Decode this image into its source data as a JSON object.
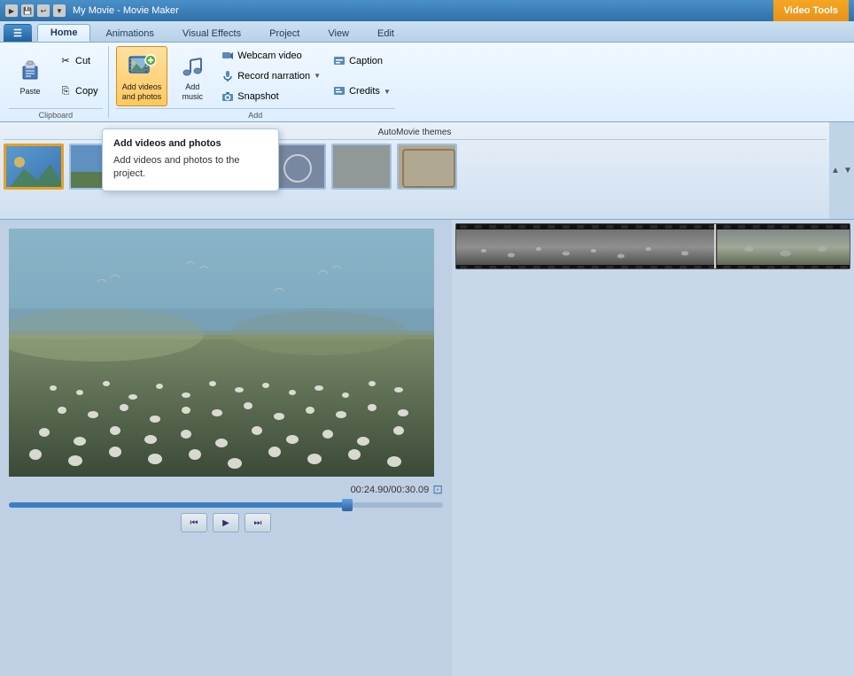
{
  "titleBar": {
    "appIcon": "▶",
    "title": "My Movie - Movie Maker",
    "videoToolsBadge": "Video Tools"
  },
  "tabs": [
    {
      "id": "app",
      "label": "≡",
      "isApp": true
    },
    {
      "id": "home",
      "label": "Home",
      "active": true
    },
    {
      "id": "animations",
      "label": "Animations"
    },
    {
      "id": "visualEffects",
      "label": "Visual Effects"
    },
    {
      "id": "project",
      "label": "Project"
    },
    {
      "id": "view",
      "label": "View"
    },
    {
      "id": "edit",
      "label": "Edit"
    }
  ],
  "ribbon": {
    "groups": [
      {
        "id": "clipboard",
        "label": "Clipboard",
        "buttons": [
          {
            "id": "paste",
            "label": "Paste",
            "size": "large",
            "icon": "paste"
          },
          {
            "id": "cut",
            "label": "Cut",
            "size": "small",
            "icon": "scissors"
          },
          {
            "id": "copy",
            "label": "Copy",
            "size": "small",
            "icon": "copy"
          }
        ]
      },
      {
        "id": "add",
        "label": "Add",
        "buttons": [
          {
            "id": "addVideos",
            "label": "Add videos\nand photos",
            "size": "large",
            "icon": "film-add",
            "active": true
          },
          {
            "id": "addMusic",
            "label": "Add\nmusic",
            "size": "large",
            "icon": "music-add"
          },
          {
            "id": "webcamVideo",
            "label": "Webcam video",
            "size": "small",
            "icon": "webcam"
          },
          {
            "id": "recordNarration",
            "label": "Record narration",
            "size": "small",
            "icon": "mic",
            "hasDropdown": true
          },
          {
            "id": "snapshot",
            "label": "Snapshot",
            "size": "small",
            "icon": "camera"
          },
          {
            "id": "caption",
            "label": "Caption",
            "size": "small",
            "icon": "caption"
          },
          {
            "id": "credits",
            "label": "Credits",
            "size": "small",
            "icon": "credits",
            "hasDropdown": true
          }
        ]
      }
    ]
  },
  "themesArea": {
    "label": "AutoMovie themes",
    "themes": [
      {
        "id": "t1",
        "selected": true,
        "colorClass": "thumb-1"
      },
      {
        "id": "t2",
        "selected": false,
        "colorClass": "thumb-2"
      },
      {
        "id": "t3",
        "selected": false,
        "colorClass": "thumb-3"
      },
      {
        "id": "t4",
        "selected": false,
        "colorClass": "thumb-4"
      },
      {
        "id": "t5",
        "selected": false,
        "colorClass": "thumb-5"
      },
      {
        "id": "t6",
        "selected": false,
        "colorClass": "thumb-6"
      },
      {
        "id": "t7",
        "selected": false,
        "colorClass": "thumb-7"
      }
    ]
  },
  "preview": {
    "timestamp": "00:24.90/00:30.09",
    "progressPercent": 78
  },
  "tooltip": {
    "title": "Add videos and photos",
    "description": "Add videos and photos to the project."
  },
  "playback": {
    "rewindLabel": "⏮",
    "playLabel": "▶",
    "forwardLabel": "⏭"
  }
}
